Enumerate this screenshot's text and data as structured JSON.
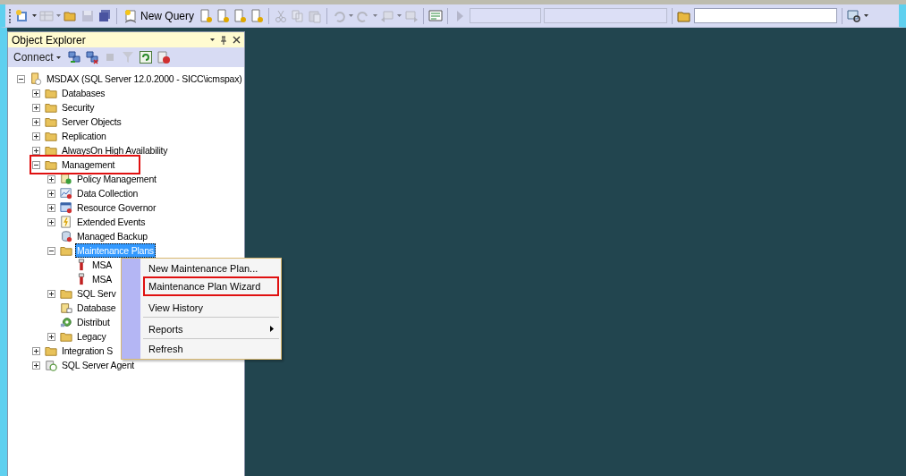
{
  "toolbar": {
    "new_query": "New Query"
  },
  "object_explorer": {
    "title": "Object Explorer",
    "connect": "Connect",
    "tree": [
      {
        "label": "MSDAX (SQL Server 12.0.2000 - SICC\\icmspax)",
        "kind": "server",
        "expandable": true,
        "expanded": true,
        "selected": false,
        "highlighted": false,
        "children": [
          {
            "label": "Databases",
            "kind": "folder",
            "expandable": true,
            "expanded": false,
            "selected": false,
            "highlighted": false
          },
          {
            "label": "Security",
            "kind": "folder",
            "expandable": true,
            "expanded": false,
            "selected": false,
            "highlighted": false
          },
          {
            "label": "Server Objects",
            "kind": "folder",
            "expandable": true,
            "expanded": false,
            "selected": false,
            "highlighted": false
          },
          {
            "label": "Replication",
            "kind": "folder",
            "expandable": true,
            "expanded": false,
            "selected": false,
            "highlighted": false
          },
          {
            "label": "AlwaysOn High Availability",
            "kind": "folder",
            "expandable": true,
            "expanded": false,
            "selected": false,
            "highlighted": false
          },
          {
            "label": "Management",
            "kind": "folder",
            "expandable": true,
            "expanded": true,
            "selected": false,
            "highlighted": true,
            "children": [
              {
                "label": "Policy Management",
                "kind": "policy",
                "expandable": true,
                "expanded": false,
                "selected": false,
                "highlighted": false
              },
              {
                "label": "Data Collection",
                "kind": "chart",
                "expandable": true,
                "expanded": false,
                "selected": false,
                "highlighted": false
              },
              {
                "label": "Resource Governor",
                "kind": "governor",
                "expandable": true,
                "expanded": false,
                "selected": false,
                "highlighted": false
              },
              {
                "label": "Extended Events",
                "kind": "events",
                "expandable": true,
                "expanded": false,
                "selected": false,
                "highlighted": false
              },
              {
                "label": "Managed Backup",
                "kind": "backup",
                "expandable": false,
                "selected": false,
                "highlighted": false
              },
              {
                "label": "Maintenance Plans",
                "kind": "folder",
                "expandable": true,
                "expanded": true,
                "selected": true,
                "highlighted": false,
                "children": [
                  {
                    "label": "MSA",
                    "kind": "plan",
                    "expandable": false,
                    "selected": false,
                    "highlighted": false
                  },
                  {
                    "label": "MSA",
                    "kind": "plan",
                    "expandable": false,
                    "selected": false,
                    "highlighted": false
                  }
                ]
              },
              {
                "label": "SQL Serv",
                "kind": "folder",
                "expandable": true,
                "expanded": false,
                "selected": false,
                "highlighted": false
              },
              {
                "label": "Database",
                "kind": "mail",
                "expandable": false,
                "selected": false,
                "highlighted": false
              },
              {
                "label": "Distribut",
                "kind": "distributor",
                "expandable": false,
                "selected": false,
                "highlighted": false
              },
              {
                "label": "Legacy",
                "kind": "folder",
                "expandable": true,
                "expanded": false,
                "selected": false,
                "highlighted": false
              }
            ]
          },
          {
            "label": "Integration S",
            "kind": "folder",
            "expandable": true,
            "expanded": false,
            "selected": false,
            "highlighted": false
          },
          {
            "label": "SQL Server Agent",
            "kind": "agent",
            "expandable": true,
            "expanded": false,
            "selected": false,
            "highlighted": false
          }
        ]
      }
    ]
  },
  "context_menu": {
    "items": [
      {
        "label": "New Maintenance Plan...",
        "submenu": false,
        "highlighted": false,
        "separator_after": false
      },
      {
        "label": "Maintenance Plan Wizard",
        "submenu": false,
        "highlighted": true,
        "separator_after": true
      },
      {
        "label": "View History",
        "submenu": false,
        "highlighted": false,
        "separator_after": true
      },
      {
        "label": "Reports",
        "submenu": true,
        "highlighted": false,
        "separator_after": true
      },
      {
        "label": "Refresh",
        "submenu": false,
        "highlighted": false,
        "separator_after": false
      }
    ]
  }
}
